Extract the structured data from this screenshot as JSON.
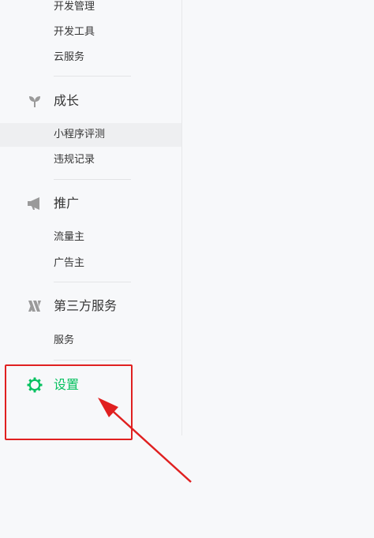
{
  "sidebar": {
    "dev_items": [
      "开发管理",
      "开发工具",
      "云服务"
    ],
    "growth": {
      "label": "成长",
      "icon": "sprout-icon",
      "items": [
        "小程序评测",
        "违规记录"
      ]
    },
    "promotion": {
      "label": "推广",
      "icon": "megaphone-icon",
      "items": [
        "流量主",
        "广告主"
      ]
    },
    "third_party": {
      "label": "第三方服务",
      "icon": "third-party-icon",
      "items": [
        "服务"
      ]
    },
    "settings": {
      "label": "设置",
      "icon": "gear-icon"
    }
  },
  "colors": {
    "accent": "#07c160",
    "annotation": "#e02020",
    "text": "#353535",
    "icon": "#9a9a9a"
  }
}
